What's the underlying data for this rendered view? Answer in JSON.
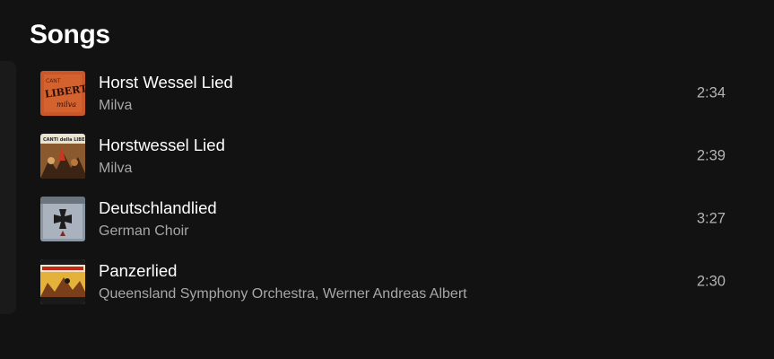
{
  "section": {
    "title": "Songs"
  },
  "songs": [
    {
      "title": "Horst Wessel Lied",
      "artist": "Milva",
      "duration": "2:34",
      "cover_icon": "liberta-album-cover"
    },
    {
      "title": "Horstwessel Lied",
      "artist": "Milva",
      "duration": "2:39",
      "cover_icon": "canti-della-liberta-album-cover"
    },
    {
      "title": "Deutschlandlied",
      "artist": "German Choir",
      "duration": "3:27",
      "cover_icon": "iron-cross-album-cover"
    },
    {
      "title": "Panzerlied",
      "artist": "Queensland Symphony Orchestra, Werner Andreas Albert",
      "duration": "2:30",
      "cover_icon": "war-movie-album-cover"
    }
  ],
  "colors": {
    "background": "#121212",
    "primary_text": "#ffffff",
    "secondary_text": "#a7a7a7"
  }
}
